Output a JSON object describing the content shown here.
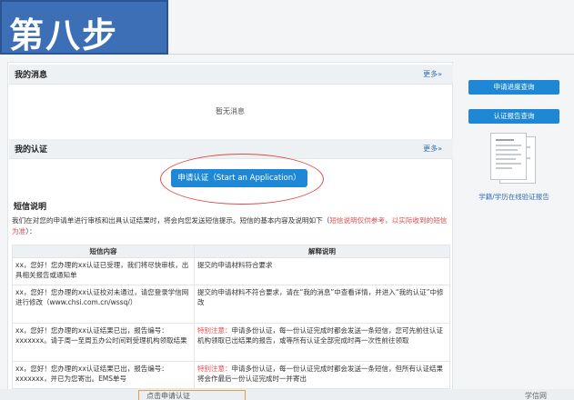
{
  "banner": {
    "text": "第八步"
  },
  "messages": {
    "title": "我的消息",
    "more": "更多»",
    "empty": "暂无消息"
  },
  "certification": {
    "title": "我的认证",
    "more": "更多»",
    "apply_button": "申请认证（Start an Application）"
  },
  "sms": {
    "title": "短信说明",
    "desc_prefix": "我们在对您的申请单进行审核和出具认证结果时，将会向您发送短信提示。短信的基本内容及说明如下（",
    "desc_red": "短信说明仅供参考，以实际收到的短信为准",
    "desc_suffix": "）：",
    "columns": [
      "短信内容",
      "解释说明"
    ],
    "rows": [
      {
        "content": "xx，您好！您办理的xx认证已受理，我们将尽快审核，出具相关报告或通知单",
        "note_red": "",
        "note": "提交的申请材料符合要求"
      },
      {
        "content": "xx，您好！您办理的xx认证校对未通过，请您登录学信网进行修改（www.chsi.com.cn/wssq/）",
        "note_red": "",
        "note": "提交的申请材料不符合要求，请在“我的消息”中查看详情，并进入“我的认证”中修改"
      },
      {
        "content": "xx，您好！您办理的xx认证结果已出，报告编号：xxxxxxx。请于周一至周五办公时间到受理机构领取结果",
        "note_red": "特别注意：",
        "note": "申请多份认证，每一份认证完成时都会发送一条短信，您可先前往认证机构领取已出结果的报告，或等所有认证全部完成时再一次性前往领取"
      },
      {
        "content": "xx，您好！您办理的xx认证结果已出，报告编号：xxxxxxx，并已为您寄出。EMS单号",
        "note_red": "特别注意：",
        "note": "申请多份认证，每一份认证完成时都会发送一条短信，但所有认证结果将会作最后一份认证完成时一并寄出"
      }
    ]
  },
  "sidebar": {
    "btn_progress": "申请进度查询",
    "btn_report": "认证报告查询",
    "link": "学籍/学历在线验证报告"
  },
  "bottom": {
    "hint": "点击申请认证",
    "right": "学信网"
  }
}
